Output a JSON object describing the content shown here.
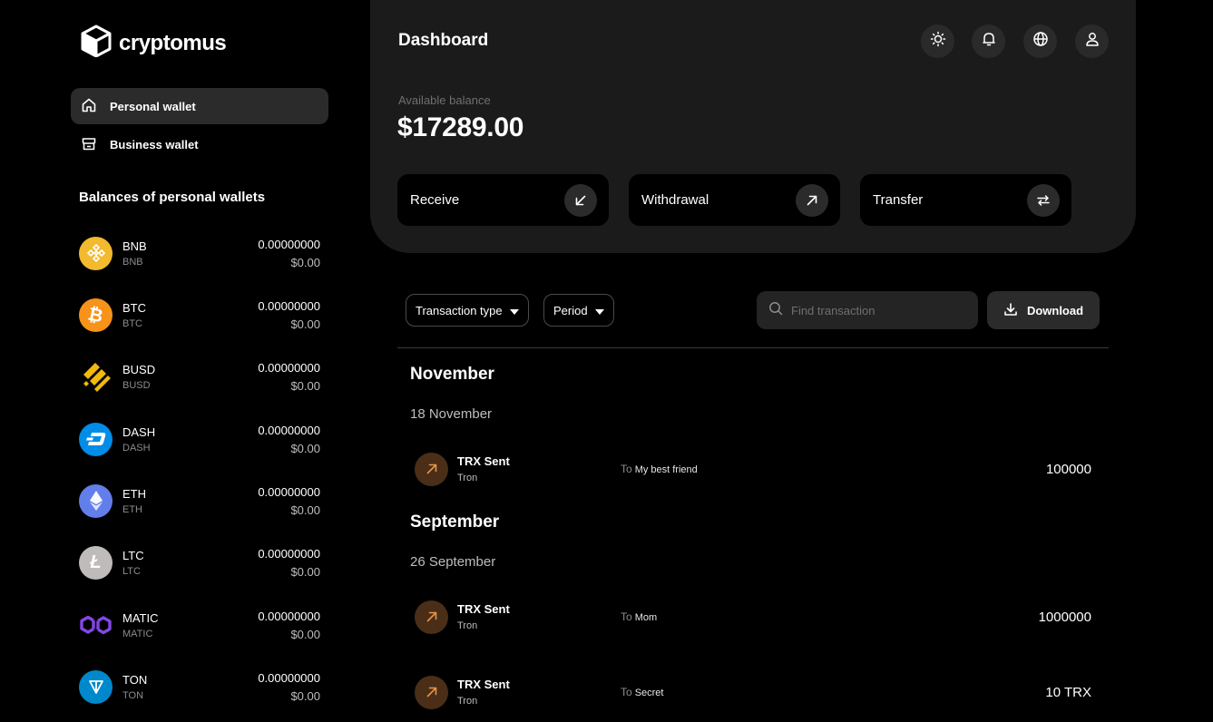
{
  "brand": {
    "name": "cryptomus"
  },
  "nav": {
    "items": [
      {
        "label": "Personal wallet",
        "icon": "home-icon",
        "active": true
      },
      {
        "label": "Business wallet",
        "icon": "store-icon",
        "active": false
      }
    ]
  },
  "balances": {
    "title": "Balances of personal wallets",
    "coins": [
      {
        "symbol": "BNB",
        "network": "BNB",
        "amount": "0.00000000",
        "usd": "$0.00",
        "color": "#f3ba2f",
        "icon": "bnb-icon"
      },
      {
        "symbol": "BTC",
        "network": "BTC",
        "amount": "0.00000000",
        "usd": "$0.00",
        "color": "#f7931a",
        "icon": "btc-icon"
      },
      {
        "symbol": "BUSD",
        "network": "BUSD",
        "amount": "0.00000000",
        "usd": "$0.00",
        "color": "#f0b90b",
        "icon": "busd-icon"
      },
      {
        "symbol": "DASH",
        "network": "DASH",
        "amount": "0.00000000",
        "usd": "$0.00",
        "color": "#008ce7",
        "icon": "dash-icon"
      },
      {
        "symbol": "ETH",
        "network": "ETH",
        "amount": "0.00000000",
        "usd": "$0.00",
        "color": "#627eea",
        "icon": "eth-icon"
      },
      {
        "symbol": "LTC",
        "network": "LTC",
        "amount": "0.00000000",
        "usd": "$0.00",
        "color": "#bfbbbb",
        "icon": "ltc-icon"
      },
      {
        "symbol": "MATIC",
        "network": "MATIC",
        "amount": "0.00000000",
        "usd": "$0.00",
        "color": "#8247e5",
        "icon": "matic-icon"
      },
      {
        "symbol": "TON",
        "network": "TON",
        "amount": "0.00000000",
        "usd": "$0.00",
        "color": "#0088cc",
        "icon": "ton-icon"
      }
    ]
  },
  "header": {
    "title": "Dashboard",
    "icons": [
      "sun-icon",
      "bell-icon",
      "globe-icon",
      "user-icon"
    ]
  },
  "balance": {
    "label": "Available balance",
    "value": "$17289.00"
  },
  "actions": [
    {
      "label": "Receive",
      "icon": "arrow-down-left-icon"
    },
    {
      "label": "Withdrawal",
      "icon": "arrow-up-right-icon"
    },
    {
      "label": "Transfer",
      "icon": "swap-arrows-icon"
    }
  ],
  "filters": {
    "transaction_type": "Transaction type",
    "period": "Period",
    "search_placeholder": "Find transaction",
    "download": "Download"
  },
  "transactions": {
    "groups": [
      {
        "month": "November",
        "days": [
          {
            "date": "18 November",
            "items": [
              {
                "title": "TRX Sent",
                "network": "Tron",
                "to_label": "To",
                "to": "My best friend",
                "amount": "100000"
              }
            ]
          }
        ]
      },
      {
        "month": "September",
        "days": [
          {
            "date": "26 September",
            "items": [
              {
                "title": "TRX Sent",
                "network": "Tron",
                "to_label": "To",
                "to": "Mom",
                "amount": "1000000"
              },
              {
                "title": "TRX Sent",
                "network": "Tron",
                "to_label": "To",
                "to": "Secret",
                "amount": "10 TRX"
              }
            ]
          }
        ]
      }
    ]
  },
  "colors": {
    "accent_tx_icon": "#4a2e17",
    "accent_tx_arrow": "#e8944a",
    "panel": "#1b1b1b"
  }
}
